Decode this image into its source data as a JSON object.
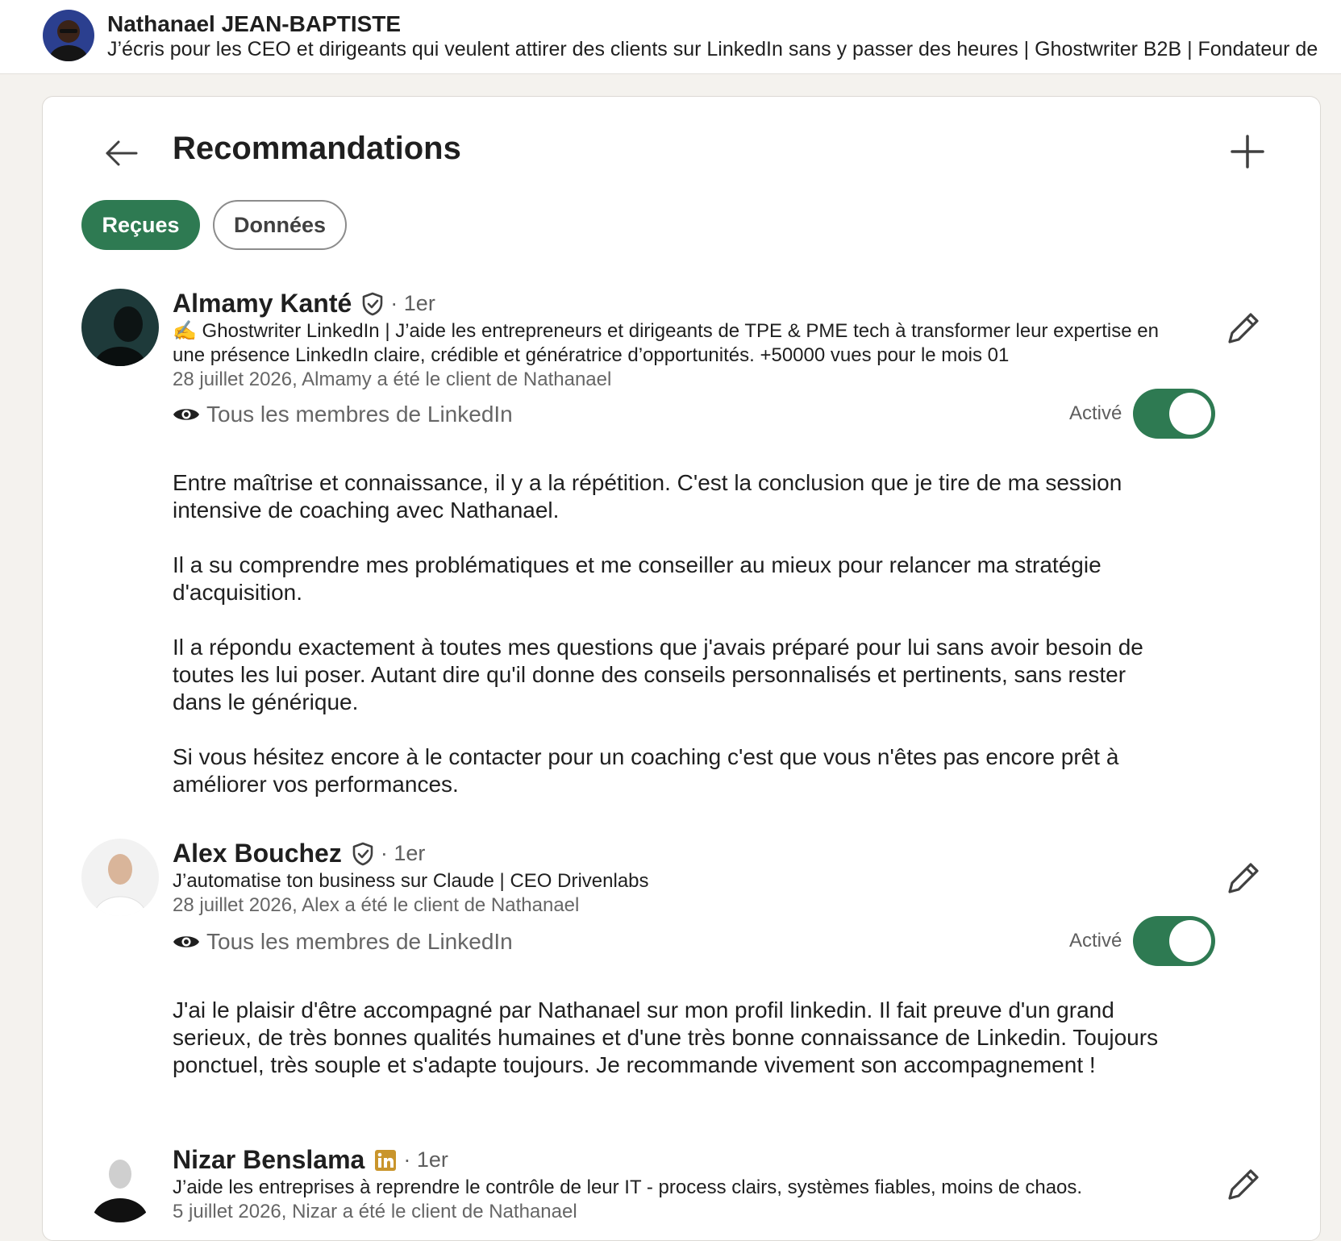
{
  "profile": {
    "name": "Nathanael JEAN-BAPTISTE",
    "headline": "J’écris pour les CEO et dirigeants qui veulent attirer des clients sur LinkedIn sans y passer des heures | Ghostwriter B2B | Fondateur de"
  },
  "page": {
    "title": "Recommandations",
    "back_icon": "arrow-left-icon",
    "add_icon": "plus-icon"
  },
  "tabs": [
    {
      "label": "Reçues",
      "active": true
    },
    {
      "label": "Données",
      "active": false
    }
  ],
  "accent_color": "#2e7a52",
  "recommendations": [
    {
      "name": "Almamy Kanté",
      "badge": "verified-shield-icon",
      "degree": "· 1er",
      "headline": "✍️ Ghostwriter LinkedIn | J’aide les entrepreneurs et  dirigeants de TPE & PME tech à transformer leur expertise en une présence LinkedIn claire, crédible et génératrice d’opportunités. +50000 vues pour le mois 01",
      "date": "28 juillet 2026, Almamy a été le client de Nathanael",
      "visibility": "Tous les membres de LinkedIn",
      "status": "Activé",
      "enabled": true,
      "text": [
        "Entre maîtrise et connaissance, il y a la répétition. C'est la conclusion que je tire de ma session intensive de coaching avec Nathanael.",
        "Il a su comprendre mes problématiques et me conseiller au mieux pour relancer ma stratégie d'acquisition.",
        "Il a répondu exactement à toutes mes questions que j'avais préparé pour lui sans avoir besoin de toutes les lui poser. Autant dire qu'il donne des conseils personnalisés et pertinents, sans rester dans le générique.",
        "Si vous hésitez encore à le contacter pour un coaching c'est que vous n'êtes pas encore prêt à améliorer vos performances."
      ]
    },
    {
      "name": "Alex Bouchez",
      "badge": "verified-shield-icon",
      "degree": "· 1er",
      "headline": "J’automatise ton business sur Claude | CEO Drivenlabs",
      "date": "28 juillet 2026, Alex a été le client de Nathanael",
      "visibility": "Tous les membres de LinkedIn",
      "status": "Activé",
      "enabled": true,
      "text": [
        "J'ai le plaisir d'être accompagné par Nathanael sur mon profil linkedin. Il fait preuve d'un grand serieux, de très bonnes qualités humaines et d'une très bonne connaissance de Linkedin. Toujours ponctuel, très souple et s'adapte toujours. Je recommande vivement son accompagnement !"
      ]
    },
    {
      "name": "Nizar Benslama",
      "badge": "linkedin-premium-icon",
      "degree": "· 1er",
      "headline": "J’aide les entreprises à reprendre le contrôle de leur IT - process clairs, systèmes fiables, moins de chaos.",
      "date": "5 juillet 2026, Nizar a été le client de Nathanael"
    }
  ]
}
